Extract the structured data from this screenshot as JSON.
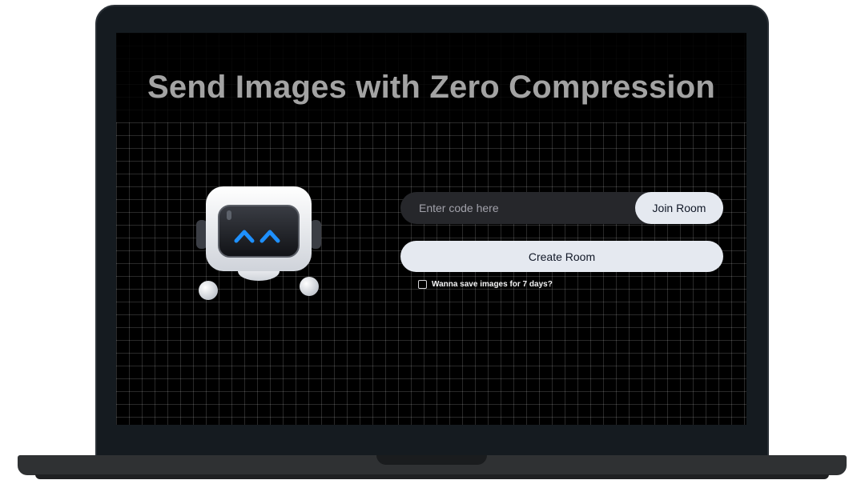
{
  "page": {
    "title": "Send Images with Zero Compression"
  },
  "join": {
    "placeholder": "Enter code here",
    "value": "",
    "button_label": "Join Room"
  },
  "create": {
    "button_label": "Create Room"
  },
  "save_option": {
    "label": "Wanna save images for 7 days?",
    "checked": false
  },
  "icons": {
    "mascot": "robot-mascot-icon"
  },
  "colors": {
    "background": "#000000",
    "bezel": "#151b20",
    "title_text": "#a3a3a3",
    "button_bg": "#e5e9f0",
    "input_bg": "#26272b",
    "robot_eye": "#1e90ff"
  }
}
